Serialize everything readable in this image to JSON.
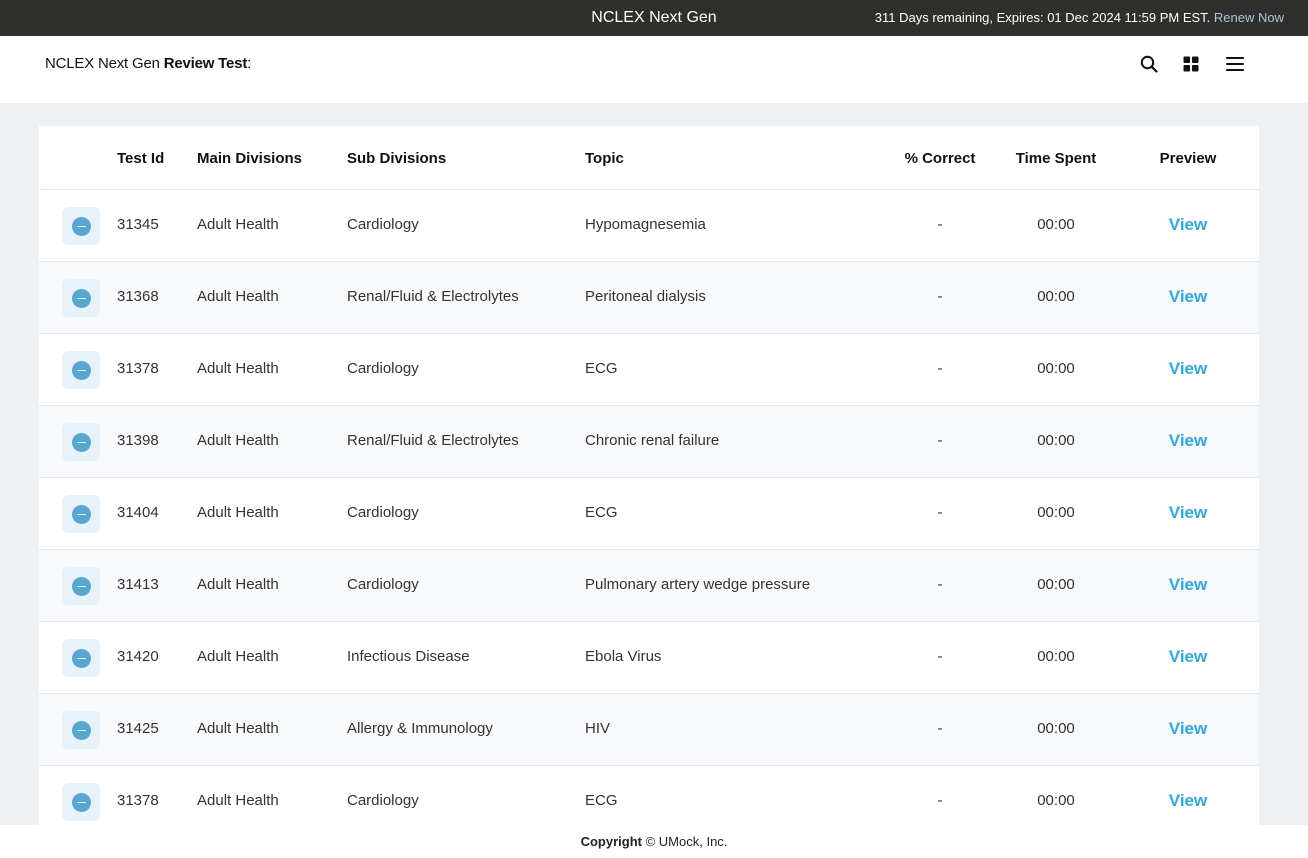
{
  "topbar": {
    "product_name": "NCLEX Next Gen",
    "expiry_text": "311 Days remaining, Expires: 01 Dec 2024 11:59 PM EST.",
    "renew_label": "Renew Now"
  },
  "header": {
    "brand_regular": "NCLEX Next Gen",
    "brand_bold": "Review Test",
    "brand_suffix": ":",
    "icons": [
      "search-icon",
      "grid-icon",
      "menu-icon"
    ]
  },
  "table": {
    "columns": {
      "test_id": "Test Id",
      "main_divisions": "Main Divisions",
      "sub_divisions": "Sub Divisions",
      "topic": "Topic",
      "percent_correct": "% Correct",
      "time_spent": "Time Spent",
      "preview": "Preview"
    },
    "rows": [
      {
        "test_id": "31345",
        "main": "Adult Health",
        "sub": "Cardiology",
        "topic": "Hypomagnesemia",
        "pct": "-",
        "time": "00:00",
        "preview": "View"
      },
      {
        "test_id": "31368",
        "main": "Adult Health",
        "sub": "Renal/Fluid & Electrolytes",
        "topic": "Peritoneal dialysis",
        "pct": "-",
        "time": "00:00",
        "preview": "View"
      },
      {
        "test_id": "31378",
        "main": "Adult Health",
        "sub": "Cardiology",
        "topic": "ECG",
        "pct": "-",
        "time": "00:00",
        "preview": "View"
      },
      {
        "test_id": "31398",
        "main": "Adult Health",
        "sub": "Renal/Fluid & Electrolytes",
        "topic": "Chronic renal failure",
        "pct": "-",
        "time": "00:00",
        "preview": "View"
      },
      {
        "test_id": "31404",
        "main": "Adult Health",
        "sub": "Cardiology",
        "topic": "ECG",
        "pct": "-",
        "time": "00:00",
        "preview": "View"
      },
      {
        "test_id": "31413",
        "main": "Adult Health",
        "sub": "Cardiology",
        "topic": "Pulmonary artery wedge pressure",
        "pct": "-",
        "time": "00:00",
        "preview": "View"
      },
      {
        "test_id": "31420",
        "main": "Adult Health",
        "sub": "Infectious Disease",
        "topic": "Ebola Virus",
        "pct": "-",
        "time": "00:00",
        "preview": "View"
      },
      {
        "test_id": "31425",
        "main": "Adult Health",
        "sub": "Allergy & Immunology",
        "topic": "HIV",
        "pct": "-",
        "time": "00:00",
        "preview": "View"
      },
      {
        "test_id": "31378",
        "main": "Adult Health",
        "sub": "Cardiology",
        "topic": "ECG",
        "pct": "-",
        "time": "00:00",
        "preview": "View"
      }
    ]
  },
  "footer": {
    "copyright_label": "Copyright",
    "copyright_text": "© UMock, Inc."
  },
  "colors": {
    "topbar_bg": "#2f302b",
    "accent_link": "#2fa8e0",
    "status_dot": "#5aa6d3"
  }
}
